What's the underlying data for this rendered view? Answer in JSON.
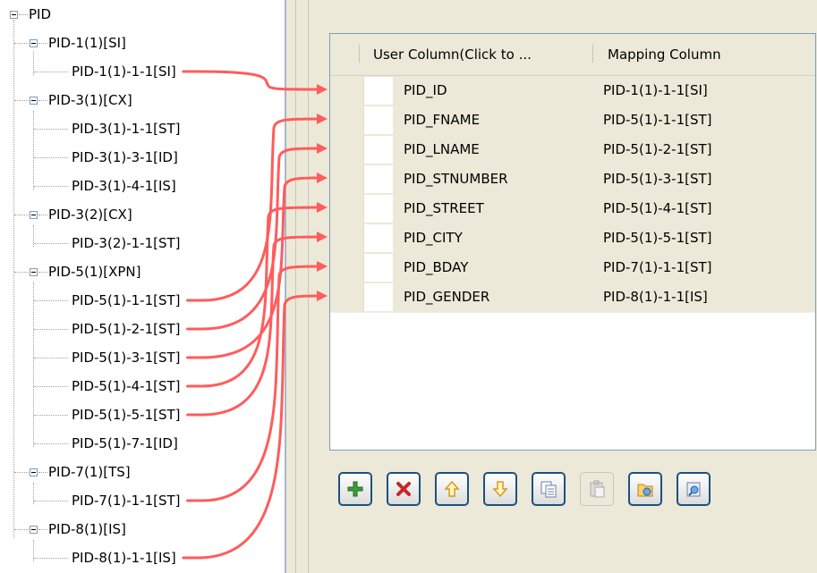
{
  "tree": {
    "root": "PID",
    "nodes": [
      {
        "label": "PID-1(1)[SI]",
        "level": 1
      },
      {
        "label": "PID-1(1)-1-1[SI]",
        "level": 2
      },
      {
        "label": "PID-3(1)[CX]",
        "level": 1
      },
      {
        "label": "PID-3(1)-1-1[ST]",
        "level": 2
      },
      {
        "label": "PID-3(1)-3-1[ID]",
        "level": 2
      },
      {
        "label": "PID-3(1)-4-1[IS]",
        "level": 2
      },
      {
        "label": "PID-3(2)[CX]",
        "level": 1
      },
      {
        "label": "PID-3(2)-1-1[ST]",
        "level": 2
      },
      {
        "label": "PID-5(1)[XPN]",
        "level": 1
      },
      {
        "label": "PID-5(1)-1-1[ST]",
        "level": 2
      },
      {
        "label": "PID-5(1)-2-1[ST]",
        "level": 2
      },
      {
        "label": "PID-5(1)-3-1[ST]",
        "level": 2
      },
      {
        "label": "PID-5(1)-4-1[ST]",
        "level": 2
      },
      {
        "label": "PID-5(1)-5-1[ST]",
        "level": 2
      },
      {
        "label": "PID-5(1)-7-1[ID]",
        "level": 2
      },
      {
        "label": "PID-7(1)[TS]",
        "level": 1
      },
      {
        "label": "PID-7(1)-1-1[ST]",
        "level": 2
      },
      {
        "label": "PID-8(1)[IS]",
        "level": 1
      },
      {
        "label": "PID-8(1)-1-1[IS]",
        "level": 2
      }
    ]
  },
  "table": {
    "headers": [
      "User Column(Click to ...",
      "Mapping Column"
    ],
    "rows": [
      {
        "user": "PID_ID",
        "mapping": "PID-1(1)-1-1[SI]"
      },
      {
        "user": "PID_FNAME",
        "mapping": "PID-5(1)-1-1[ST]"
      },
      {
        "user": "PID_LNAME",
        "mapping": "PID-5(1)-2-1[ST]"
      },
      {
        "user": "PID_STNUMBER",
        "mapping": "PID-5(1)-3-1[ST]"
      },
      {
        "user": "PID_STREET",
        "mapping": "PID-5(1)-4-1[ST]"
      },
      {
        "user": "PID_CITY",
        "mapping": "PID-5(1)-5-1[ST]"
      },
      {
        "user": "PID_BDAY",
        "mapping": "PID-7(1)-1-1[ST]"
      },
      {
        "user": "PID_GENDER",
        "mapping": "PID-8(1)-1-1[IS]"
      }
    ]
  },
  "toolbar": {
    "buttons": [
      {
        "icon": "add-icon",
        "enabled": true
      },
      {
        "icon": "delete-icon",
        "enabled": true
      },
      {
        "icon": "move-up-icon",
        "enabled": true
      },
      {
        "icon": "move-down-icon",
        "enabled": true
      },
      {
        "icon": "copy-icon",
        "enabled": true
      },
      {
        "icon": "paste-icon",
        "enabled": false
      },
      {
        "icon": "import-icon",
        "enabled": true
      },
      {
        "icon": "export-icon",
        "enabled": true
      }
    ]
  },
  "mappings": [
    {
      "source": "PID-1(1)-1-1[SI]",
      "target": "PID_ID"
    },
    {
      "source": "PID-5(1)-1-1[ST]",
      "target": "PID_FNAME"
    },
    {
      "source": "PID-5(1)-2-1[ST]",
      "target": "PID_LNAME"
    },
    {
      "source": "PID-5(1)-3-1[ST]",
      "target": "PID_STNUMBER"
    },
    {
      "source": "PID-5(1)-4-1[ST]",
      "target": "PID_STREET"
    },
    {
      "source": "PID-5(1)-5-1[ST]",
      "target": "PID_CITY"
    },
    {
      "source": "PID-7(1)-1-1[ST]",
      "target": "PID_BDAY"
    },
    {
      "source": "PID-8(1)-1-1[IS]",
      "target": "PID_GENDER"
    }
  ],
  "colors": {
    "link_arrow": "#ff5c5c",
    "panel_bg": "#ece9d8",
    "button_border": "#1c5180"
  }
}
